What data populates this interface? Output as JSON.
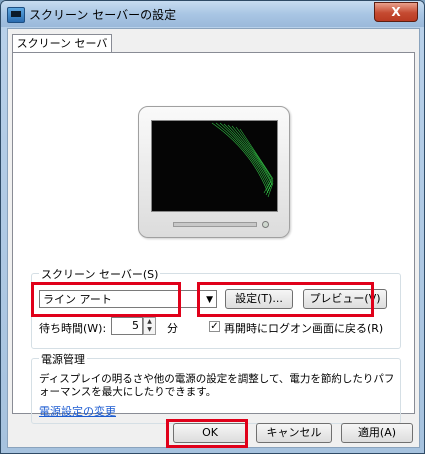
{
  "window": {
    "title": "スクリーン セーバーの設定",
    "close_glyph": "X"
  },
  "tab": {
    "label": "スクリーン セーバー"
  },
  "screensaver": {
    "group_label": "スクリーン セーバー(S)",
    "selected": "ライン アート",
    "settings_button": "設定(T)...",
    "preview_button": "プレビュー(V)",
    "wait_label": "待ち時間(W):",
    "wait_value": "5",
    "wait_unit": "分",
    "resume_checkbox_label": "再開時にログオン画面に戻る(R)",
    "resume_checked": true
  },
  "power": {
    "group_label": "電源管理",
    "description_line1": "ディスプレイの明るさや他の電源の設定を調整して、電力を節約したりパフ",
    "description_line2": "ォーマンスを最大にしたりできます。",
    "link": "電源設定の変更"
  },
  "footer": {
    "ok_button": "OK",
    "cancel_button": "キャンセル",
    "apply_button": "適用(A)"
  },
  "colors": {
    "highlight_box": "#e0001a",
    "link": "#1a5ad0",
    "line_art": "#36d14a"
  }
}
